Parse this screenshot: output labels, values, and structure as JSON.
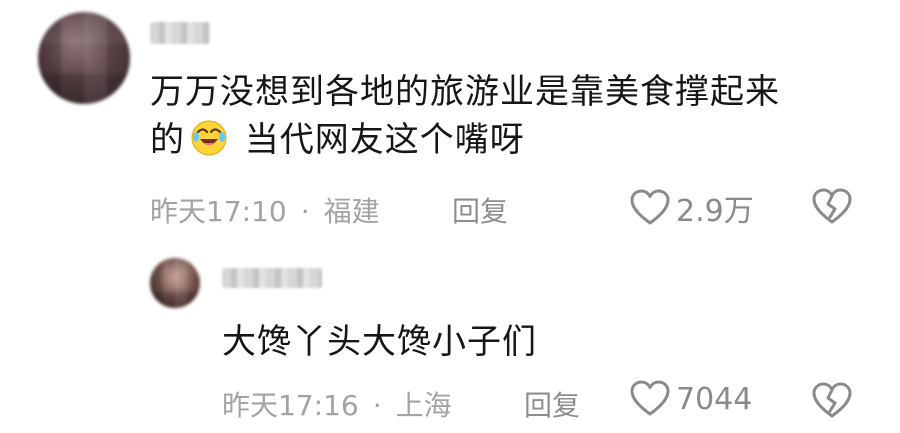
{
  "comments": [
    {
      "text_line1": "万万没想到各地的旅游业是靠美食撑起来",
      "text_line2_pre": "的",
      "text_line2_post": " 当代网友这个嘴呀",
      "emoji_icon": "laughing-tears-emoji",
      "time": "昨天17:10",
      "separator": "·",
      "location": "福建",
      "reply_label": "回复",
      "likes": "2.9万"
    }
  ],
  "replies": [
    {
      "text": "大馋丫头大馋小子们",
      "time": "昨天17:16",
      "separator": "·",
      "location": "上海",
      "reply_label": "回复",
      "likes": "7044"
    }
  ],
  "icons": {
    "like": "heart-outline-icon",
    "dislike": "broken-heart-icon"
  }
}
